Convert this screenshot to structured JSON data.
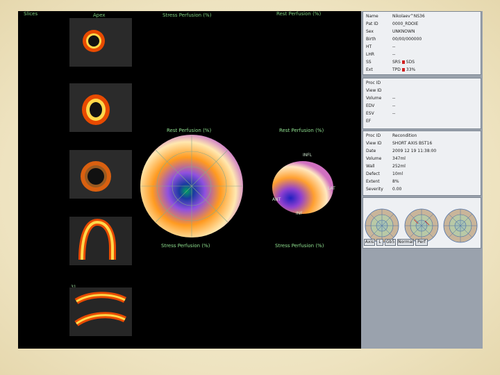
{
  "headers": {
    "left": "Slices",
    "mid": "Apex",
    "stress": "Stress Perfusion (%)",
    "rest": "Rest Perfusion (%)"
  },
  "slices": [
    {
      "num": "12"
    },
    {
      "num": "13"
    },
    {
      "num": "15"
    },
    {
      "num": "32"
    },
    {
      "num": "31"
    }
  ],
  "maps": {
    "rest_title": "Rest Perfusion (%)",
    "rest_bottom": "Stress Perfusion (%)",
    "small_title": "Rest Perfusion (%)",
    "small_bottom": "Stress Perfusion (%)",
    "labels": {
      "infl": "INFL",
      "ant": "ANT",
      "lat": "LAT",
      "sep": "SEP",
      "inf": "INF"
    }
  },
  "panel": {
    "patient": [
      {
        "k": "Name",
        "v": "Nikolaev^NS36"
      },
      {
        "k": "Pat ID",
        "v": "0000_RDOIE"
      },
      {
        "k": "Sex",
        "v": "UNKNOWN"
      },
      {
        "k": "Birth",
        "v": "00/00/000000"
      },
      {
        "k": "HT",
        "v": "--"
      },
      {
        "k": "LHR",
        "v": "--"
      },
      {
        "k": "SS",
        "v": "SRS",
        "v2": "SDS"
      },
      {
        "k": "Ext",
        "v": "TPD",
        "v2": "33%"
      }
    ],
    "study1": [
      {
        "k": "Proc ID",
        "v": ""
      },
      {
        "k": "View ID",
        "v": ""
      },
      {
        "k": "Volume",
        "v": "--"
      },
      {
        "k": "EDV",
        "v": "--"
      },
      {
        "k": "ESV",
        "v": "--"
      },
      {
        "k": "EF",
        "v": ""
      }
    ],
    "study2": [
      {
        "k": "Proc ID",
        "v": "Recondition"
      },
      {
        "k": "View ID",
        "v": "SHORT AXIS BST16"
      },
      {
        "k": "Date",
        "v": "2009 12 19 11:38:00"
      },
      {
        "k": "Volume",
        "v": "347ml"
      },
      {
        "k": "Wall",
        "v": "252ml"
      },
      {
        "k": "Defect",
        "v": "10ml"
      },
      {
        "k": "Extent",
        "v": "8%"
      },
      {
        "k": "Severity",
        "v": "0.00"
      }
    ],
    "buttons": [
      "Axis",
      "L",
      "Gb5",
      "Normal",
      "Perf"
    ]
  },
  "colors": {
    "panel": "#9aa2ad",
    "section": "#eef0f3",
    "heart_outer": "#ff7a00",
    "heart_inner": "#ffd23a"
  }
}
